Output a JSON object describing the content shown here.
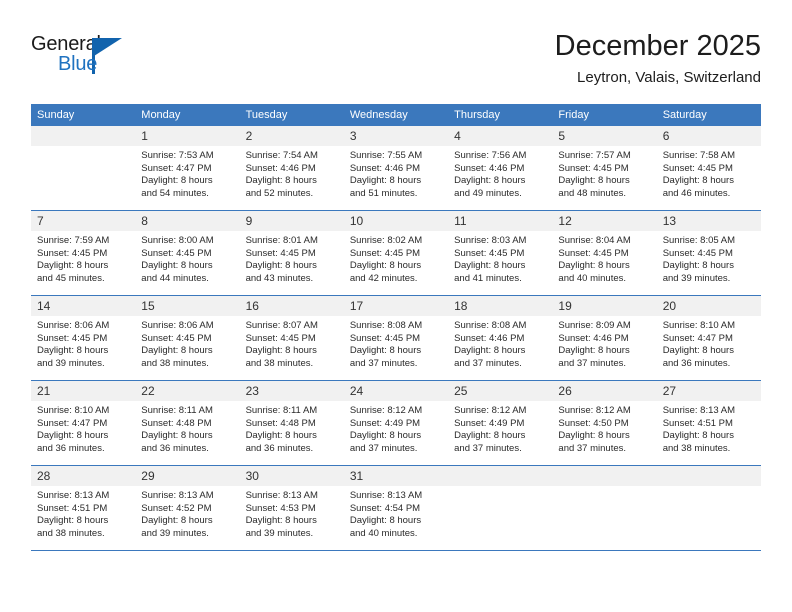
{
  "brand": {
    "name_top": "General",
    "name_bottom": "Blue",
    "accent_color": "#1163ad",
    "text_color": "#1b1b1b"
  },
  "header": {
    "title": "December 2025",
    "subtitle": "Leytron, Valais, Switzerland"
  },
  "theme": {
    "header_row_bg": "#3b78bd",
    "header_row_text": "#ffffff",
    "daynum_bg": "#f1f1f1",
    "row_border": "#3b78bd"
  },
  "weekday_headers": [
    "Sunday",
    "Monday",
    "Tuesday",
    "Wednesday",
    "Thursday",
    "Friday",
    "Saturday"
  ],
  "weeks": [
    [
      {
        "day": "",
        "lines": []
      },
      {
        "day": "1",
        "lines": [
          "Sunrise: 7:53 AM",
          "Sunset: 4:47 PM",
          "Daylight: 8 hours",
          "and 54 minutes."
        ]
      },
      {
        "day": "2",
        "lines": [
          "Sunrise: 7:54 AM",
          "Sunset: 4:46 PM",
          "Daylight: 8 hours",
          "and 52 minutes."
        ]
      },
      {
        "day": "3",
        "lines": [
          "Sunrise: 7:55 AM",
          "Sunset: 4:46 PM",
          "Daylight: 8 hours",
          "and 51 minutes."
        ]
      },
      {
        "day": "4",
        "lines": [
          "Sunrise: 7:56 AM",
          "Sunset: 4:46 PM",
          "Daylight: 8 hours",
          "and 49 minutes."
        ]
      },
      {
        "day": "5",
        "lines": [
          "Sunrise: 7:57 AM",
          "Sunset: 4:45 PM",
          "Daylight: 8 hours",
          "and 48 minutes."
        ]
      },
      {
        "day": "6",
        "lines": [
          "Sunrise: 7:58 AM",
          "Sunset: 4:45 PM",
          "Daylight: 8 hours",
          "and 46 minutes."
        ]
      }
    ],
    [
      {
        "day": "7",
        "lines": [
          "Sunrise: 7:59 AM",
          "Sunset: 4:45 PM",
          "Daylight: 8 hours",
          "and 45 minutes."
        ]
      },
      {
        "day": "8",
        "lines": [
          "Sunrise: 8:00 AM",
          "Sunset: 4:45 PM",
          "Daylight: 8 hours",
          "and 44 minutes."
        ]
      },
      {
        "day": "9",
        "lines": [
          "Sunrise: 8:01 AM",
          "Sunset: 4:45 PM",
          "Daylight: 8 hours",
          "and 43 minutes."
        ]
      },
      {
        "day": "10",
        "lines": [
          "Sunrise: 8:02 AM",
          "Sunset: 4:45 PM",
          "Daylight: 8 hours",
          "and 42 minutes."
        ]
      },
      {
        "day": "11",
        "lines": [
          "Sunrise: 8:03 AM",
          "Sunset: 4:45 PM",
          "Daylight: 8 hours",
          "and 41 minutes."
        ]
      },
      {
        "day": "12",
        "lines": [
          "Sunrise: 8:04 AM",
          "Sunset: 4:45 PM",
          "Daylight: 8 hours",
          "and 40 minutes."
        ]
      },
      {
        "day": "13",
        "lines": [
          "Sunrise: 8:05 AM",
          "Sunset: 4:45 PM",
          "Daylight: 8 hours",
          "and 39 minutes."
        ]
      }
    ],
    [
      {
        "day": "14",
        "lines": [
          "Sunrise: 8:06 AM",
          "Sunset: 4:45 PM",
          "Daylight: 8 hours",
          "and 39 minutes."
        ]
      },
      {
        "day": "15",
        "lines": [
          "Sunrise: 8:06 AM",
          "Sunset: 4:45 PM",
          "Daylight: 8 hours",
          "and 38 minutes."
        ]
      },
      {
        "day": "16",
        "lines": [
          "Sunrise: 8:07 AM",
          "Sunset: 4:45 PM",
          "Daylight: 8 hours",
          "and 38 minutes."
        ]
      },
      {
        "day": "17",
        "lines": [
          "Sunrise: 8:08 AM",
          "Sunset: 4:45 PM",
          "Daylight: 8 hours",
          "and 37 minutes."
        ]
      },
      {
        "day": "18",
        "lines": [
          "Sunrise: 8:08 AM",
          "Sunset: 4:46 PM",
          "Daylight: 8 hours",
          "and 37 minutes."
        ]
      },
      {
        "day": "19",
        "lines": [
          "Sunrise: 8:09 AM",
          "Sunset: 4:46 PM",
          "Daylight: 8 hours",
          "and 37 minutes."
        ]
      },
      {
        "day": "20",
        "lines": [
          "Sunrise: 8:10 AM",
          "Sunset: 4:47 PM",
          "Daylight: 8 hours",
          "and 36 minutes."
        ]
      }
    ],
    [
      {
        "day": "21",
        "lines": [
          "Sunrise: 8:10 AM",
          "Sunset: 4:47 PM",
          "Daylight: 8 hours",
          "and 36 minutes."
        ]
      },
      {
        "day": "22",
        "lines": [
          "Sunrise: 8:11 AM",
          "Sunset: 4:48 PM",
          "Daylight: 8 hours",
          "and 36 minutes."
        ]
      },
      {
        "day": "23",
        "lines": [
          "Sunrise: 8:11 AM",
          "Sunset: 4:48 PM",
          "Daylight: 8 hours",
          "and 36 minutes."
        ]
      },
      {
        "day": "24",
        "lines": [
          "Sunrise: 8:12 AM",
          "Sunset: 4:49 PM",
          "Daylight: 8 hours",
          "and 37 minutes."
        ]
      },
      {
        "day": "25",
        "lines": [
          "Sunrise: 8:12 AM",
          "Sunset: 4:49 PM",
          "Daylight: 8 hours",
          "and 37 minutes."
        ]
      },
      {
        "day": "26",
        "lines": [
          "Sunrise: 8:12 AM",
          "Sunset: 4:50 PM",
          "Daylight: 8 hours",
          "and 37 minutes."
        ]
      },
      {
        "day": "27",
        "lines": [
          "Sunrise: 8:13 AM",
          "Sunset: 4:51 PM",
          "Daylight: 8 hours",
          "and 38 minutes."
        ]
      }
    ],
    [
      {
        "day": "28",
        "lines": [
          "Sunrise: 8:13 AM",
          "Sunset: 4:51 PM",
          "Daylight: 8 hours",
          "and 38 minutes."
        ]
      },
      {
        "day": "29",
        "lines": [
          "Sunrise: 8:13 AM",
          "Sunset: 4:52 PM",
          "Daylight: 8 hours",
          "and 39 minutes."
        ]
      },
      {
        "day": "30",
        "lines": [
          "Sunrise: 8:13 AM",
          "Sunset: 4:53 PM",
          "Daylight: 8 hours",
          "and 39 minutes."
        ]
      },
      {
        "day": "31",
        "lines": [
          "Sunrise: 8:13 AM",
          "Sunset: 4:54 PM",
          "Daylight: 8 hours",
          "and 40 minutes."
        ]
      },
      {
        "day": "",
        "lines": []
      },
      {
        "day": "",
        "lines": []
      },
      {
        "day": "",
        "lines": []
      }
    ]
  ]
}
